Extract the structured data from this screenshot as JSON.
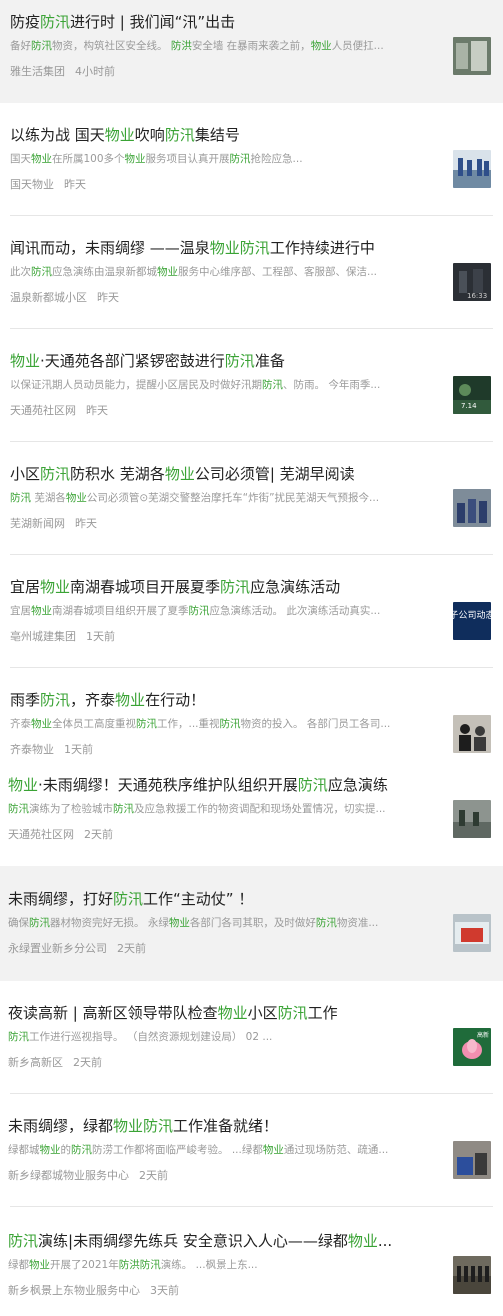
{
  "feed": {
    "items": [
      {
        "title": "防疫防汛进行时 | 我们闻“汛”出击",
        "snippet": "备好防汛物资，构筑社区安全线。 防洪安全墙 在暴雨来袭之前，物业人员便扛...",
        "source": "雅生活集团",
        "time": "4小时前",
        "thumb": "t1",
        "bg": "gray"
      },
      {
        "title": "以练为战 国天物业吹响防汛集结号",
        "snippet": "国天物业在所属100多个物业服务项目认真开展防汛抢险应急...",
        "source": "国天物业",
        "time": "昨天",
        "thumb": "t2",
        "bg": "white"
      },
      {
        "title": "闻讯而动，未雨绸缪 ——温泉物业防汛工作持续进行中",
        "snippet": "此次防汛应急演练由温泉新都城物业服务中心维序部、工程部、客服部、保洁...",
        "source": "温泉新都城小区",
        "time": "昨天",
        "thumb": "t3",
        "bg": "white",
        "thumb_text": "16:33"
      },
      {
        "title": "物业·天通苑各部门紧锣密鼓进行防汛准备",
        "snippet": "以保证汛期人员动员能力，提醒小区居民及时做好汛期防汛、防雨。 今年雨季...",
        "source": "天通苑社区网",
        "time": "昨天",
        "thumb": "t4",
        "bg": "white",
        "thumb_text": "7.14"
      },
      {
        "title": "小区防汛防积水 芜湖各物业公司必须管| 芜湖早阅读",
        "snippet": "防汛 芜湖各物业公司必须管⊙芜湖交警整治摩托车“炸街”扰民芜湖天气预报今...",
        "source": "芜湖新闻网",
        "time": "昨天",
        "thumb": "t5",
        "bg": "white"
      },
      {
        "title": "宜居物业南湖春城项目开展夏季防汛应急演练活动",
        "snippet": "宜居物业南湖春城项目组织开展了夏季防汛应急演练活动。 此次演练活动真实...",
        "source": "亳州城建集团",
        "time": "1天前",
        "thumb": "t6",
        "bg": "white",
        "thumb_text": "子公司动态"
      },
      {
        "title": "雨季防汛，齐泰物业在行动！",
        "snippet": "齐泰物业全体员工高度重视防汛工作，...重视防汛物资的投入。 各部门员工各司...",
        "source": "齐泰物业",
        "time": "1天前",
        "thumb": "t7",
        "bg": "white"
      },
      {
        "title": "物业·未雨绸缪！天通苑秩序维护队组织开展防汛应急演练",
        "snippet": "防汛演练为了检验城市防汛及应急救援工作的物资调配和现场处置情况，切实提...",
        "source": "天通苑社区网",
        "time": "2天前",
        "thumb": "t8",
        "bg": "white"
      },
      {
        "title": "未雨绸缪，打好防汛工作“主动仗” ！",
        "snippet": "确保防汛器材物资完好无损。 永绿物业各部门各司其职，及时做好防汛物资准...",
        "source": "永绿置业新乡分公司",
        "time": "2天前",
        "thumb": "t9",
        "bg": "gray"
      },
      {
        "title": "夜读高新 | 高新区领导带队检查物业小区防汛工作",
        "snippet": "防汛工作进行巡视指导。 （自然资源规划建设局） 02 ...",
        "source": "新乡高新区",
        "time": "2天前",
        "thumb": "t10",
        "bg": "white",
        "thumb_text": "高新"
      },
      {
        "title": "未雨绸缪，绿都物业防汛工作准备就绪！",
        "snippet": "绿都城物业的防汛防涝工作都将面临严峻考验。 ...绿都物业通过现场防范、疏通...",
        "source": "新乡绿都城物业服务中心",
        "time": "2天前",
        "thumb": "t11",
        "bg": "white"
      },
      {
        "title": "防汛演练|未雨绸缪先练兵 安全意识入人心——绿都物业...",
        "snippet": "绿都物业开展了2021年防洪防汛演练。 ...枫景上东...",
        "source": "新乡枫景上东物业服务中心",
        "time": "3天前",
        "thumb": "t12",
        "bg": "white"
      }
    ],
    "highlight_color": "#3aa335"
  }
}
